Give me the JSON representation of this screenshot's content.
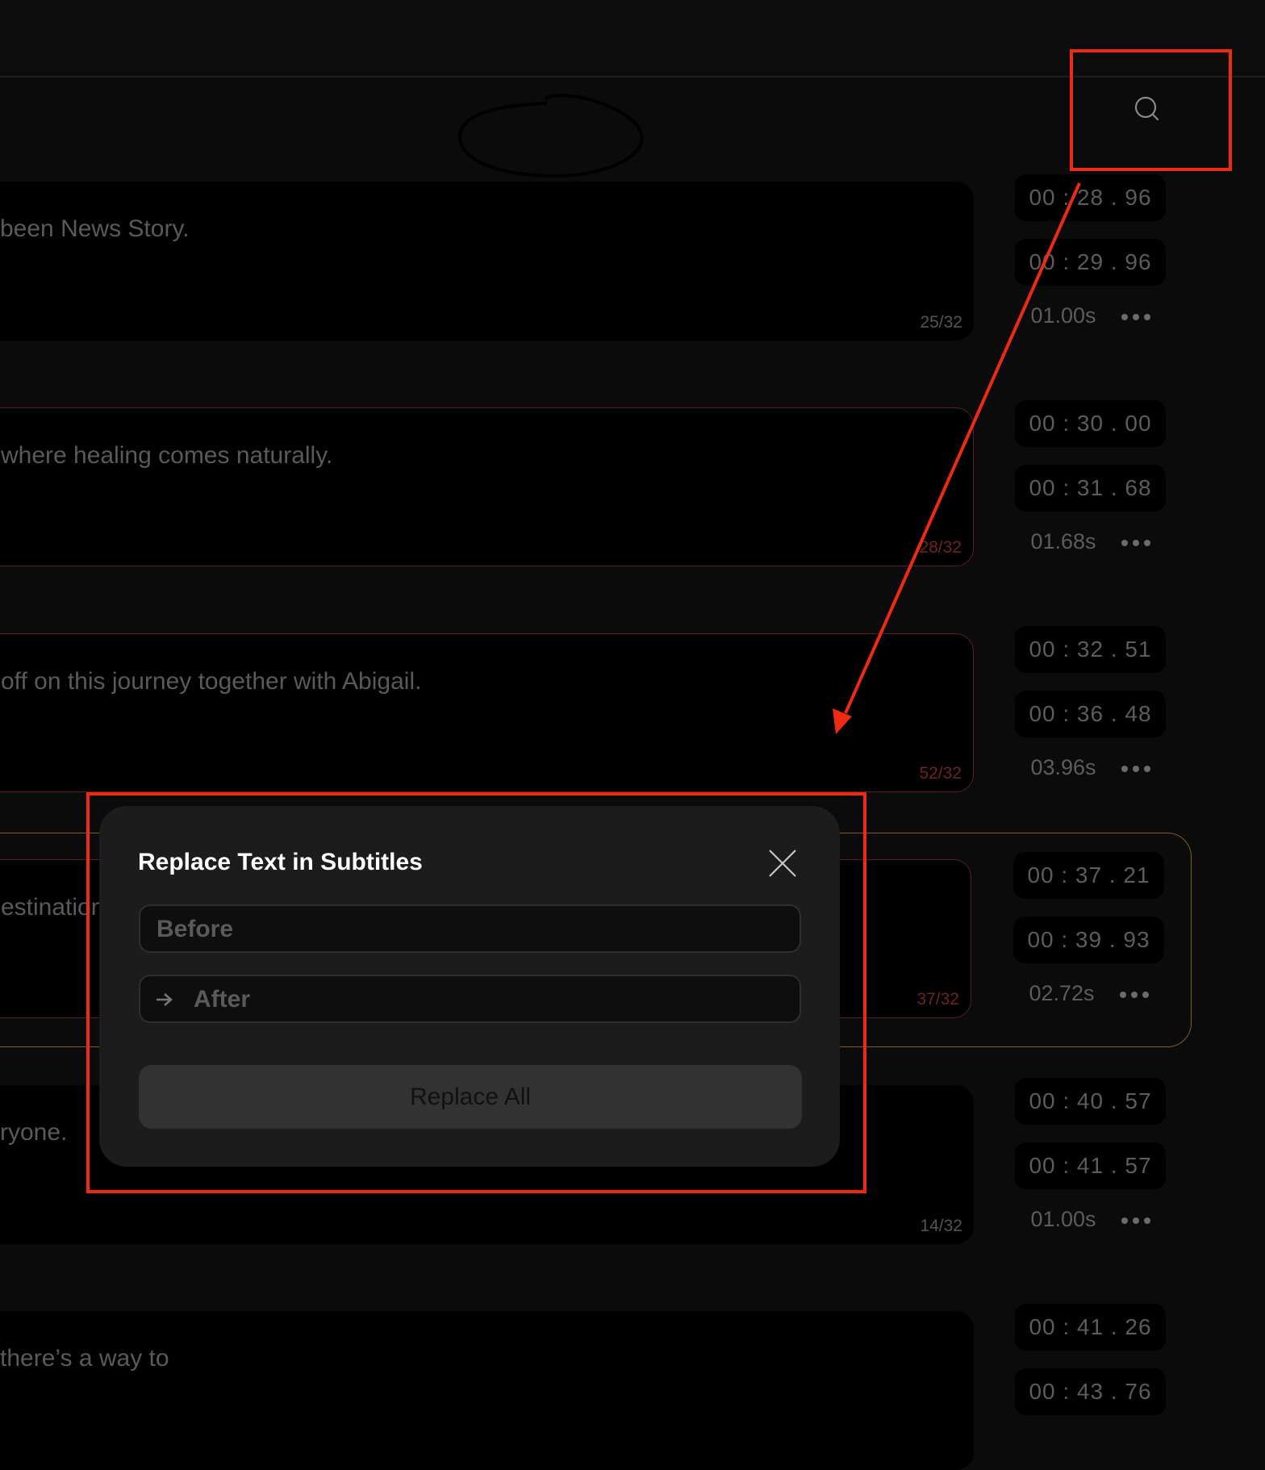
{
  "rows": [
    {
      "text": "been News Story.",
      "counter": "25/32",
      "counter_error": false,
      "start": "00 : 28 . 96",
      "end": "00 : 29 . 96",
      "duration": "01.00s",
      "error": false
    },
    {
      "text": "where healing comes naturally.",
      "counter": "28/32",
      "counter_error": true,
      "start": "00 : 30 . 00",
      "end": "00 : 31 . 68",
      "duration": "01.68s",
      "error": true
    },
    {
      "text": "off on this journey together with Abigail.",
      "counter": "52/32",
      "counter_error": true,
      "start": "00 : 32 . 51",
      "end": "00 : 36 . 48",
      "duration": "03.96s",
      "error": true
    },
    {
      "text": "estination",
      "counter": "37/32",
      "counter_error": true,
      "start": "00 : 37 . 21",
      "end": "00 : 39 . 93",
      "duration": "02.72s",
      "error": true,
      "selected": true
    },
    {
      "text": "ryone.",
      "counter": "14/32",
      "counter_error": false,
      "start": "00 : 40 . 57",
      "end": "00 : 41 . 57",
      "duration": "01.00s",
      "error": false
    },
    {
      "text": " there’s a way to",
      "counter": null,
      "counter_error": false,
      "start": "00 : 41 . 26",
      "end": "00 : 43 . 76",
      "duration": null,
      "error": false
    }
  ],
  "modal": {
    "title": "Replace Text in Subtitles",
    "before_placeholder": "Before",
    "after_placeholder": "After",
    "replace_all_label": "Replace All"
  },
  "colors": {
    "accent_annotation": "#ee2a12",
    "error_border": "#5e1c1c",
    "selected_border": "#7a5e28"
  }
}
